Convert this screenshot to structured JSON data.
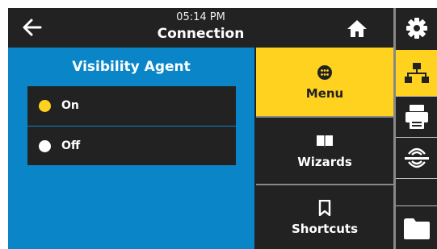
{
  "header": {
    "time": "05:14 PM",
    "title": "Connection"
  },
  "panel": {
    "title": "Visibility Agent",
    "options": [
      {
        "label": "On",
        "selected": true,
        "color": "#ffd21f"
      },
      {
        "label": "Off",
        "selected": false,
        "color": "#ffffff"
      }
    ]
  },
  "menu": {
    "items": [
      {
        "label": "Menu",
        "icon": "menu-dots-icon",
        "active": true
      },
      {
        "label": "Wizards",
        "icon": "book-icon",
        "active": false
      },
      {
        "label": "Shortcuts",
        "icon": "bookmark-icon",
        "active": false
      }
    ]
  },
  "sidebar": {
    "icons": [
      "gear-icon",
      "network-icon",
      "printer-icon",
      "rfid-icon",
      "folder-icon"
    ],
    "active": "network-icon"
  },
  "colors": {
    "accent": "#ffd21f",
    "panel": "#0a86c8",
    "dark": "#222222"
  }
}
